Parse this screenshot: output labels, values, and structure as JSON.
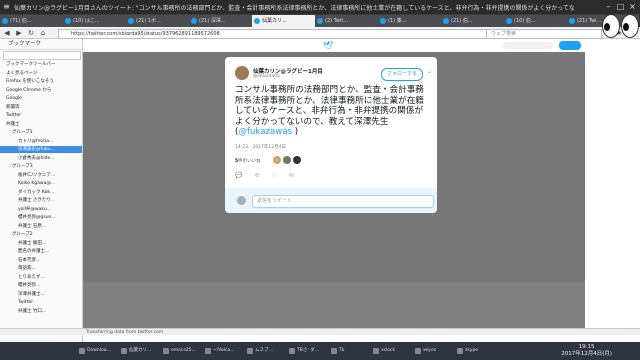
{
  "window": {
    "title": "仙葉カリン@ラグビー1月目さんのツイート: \"コンサル事務所の法務部門とか、監査・会計事務所系法律事務所とか、法律事務所に他士業が在籍しているケースと、非弁行為・非弁提携の関係がよく分かってないので、教えて深澤先生(@fukazawas )\" - Mozilla Firefox"
  },
  "tabs": [
    {
      "label": "(71) 伯..."
    },
    {
      "label": "(10) はこ..."
    },
    {
      "label": "(21) 1ボ..."
    },
    {
      "label": "(21) 深澤..."
    },
    {
      "label": "仙葉カリ..."
    },
    {
      "label": "(2) Twit..."
    },
    {
      "label": "(1) 藤..."
    },
    {
      "label": "(21) 伯..."
    },
    {
      "label": "(10) 伯..."
    },
    {
      "label": "(21) Twi..."
    }
  ],
  "nav": {
    "url": "https://twitter.com/sbiarda95/status/937962891189572608",
    "search_placeholder": "ウェブ検索"
  },
  "sidebar": {
    "header": "ブックマーク",
    "items": [
      "ブックマークツールバー",
      "よく見るページ",
      "Firefox を使いこなそう",
      "Google Chrome から",
      "Google",
      "新聞等",
      "Twitter",
      "弁護士",
      "グループ1",
      "カトリ@fnoria...",
      "深澤諭史@fuku...",
      "小倉秀夫@hide...",
      "グループ3",
      "板井仁/ソクニア...",
      "Koiko Kgawa@...",
      "ダイカック Kok...",
      "弁護士 さきたり...",
      "yoll弁@waku...",
      "櫻井亮弥@gsun...",
      "弁護士 石原...",
      "グループ2",
      "弁護士 飯田...",
      "匿名の弁護士...",
      "石本芳彦...",
      "落語家...",
      "とりあえず...",
      "櫻井亮弥...",
      "深澤弁護士...",
      "Twitter",
      "弁護士 竹口..."
    ]
  },
  "status_text": "Transferring data from twitter.com",
  "modal": {
    "name": "仙葉カリン@ラグビー1月目",
    "handle": "@sbiarda95",
    "follow": "フォローする",
    "tweet_text": "コンサル事務所の法務部門とか、監査・会計事務所系法律事務所とか、法律事務所に他士業が在籍しているケースと、非弁行為・非弁提携の関係がよく分かってないので、教えて深澤先生(",
    "mention": "@fukazawas",
    "tweet_end": " )",
    "date": "14:23 - 2017年12月4日",
    "likes_count": "5",
    "likes_label": "件のいいね",
    "reply_placeholder": "返信をツイート"
  },
  "taskbar": {
    "tasks": [
      "Downloa...",
      "仙葉カリ...",
      "emacs25...",
      "~/Volca...",
      "ムスプ...",
      "TBさ: ダ...",
      "Tk",
      "xclock",
      "xeyes",
      "skype"
    ],
    "time": "19:15",
    "date": "2017年12月4日(月)"
  }
}
